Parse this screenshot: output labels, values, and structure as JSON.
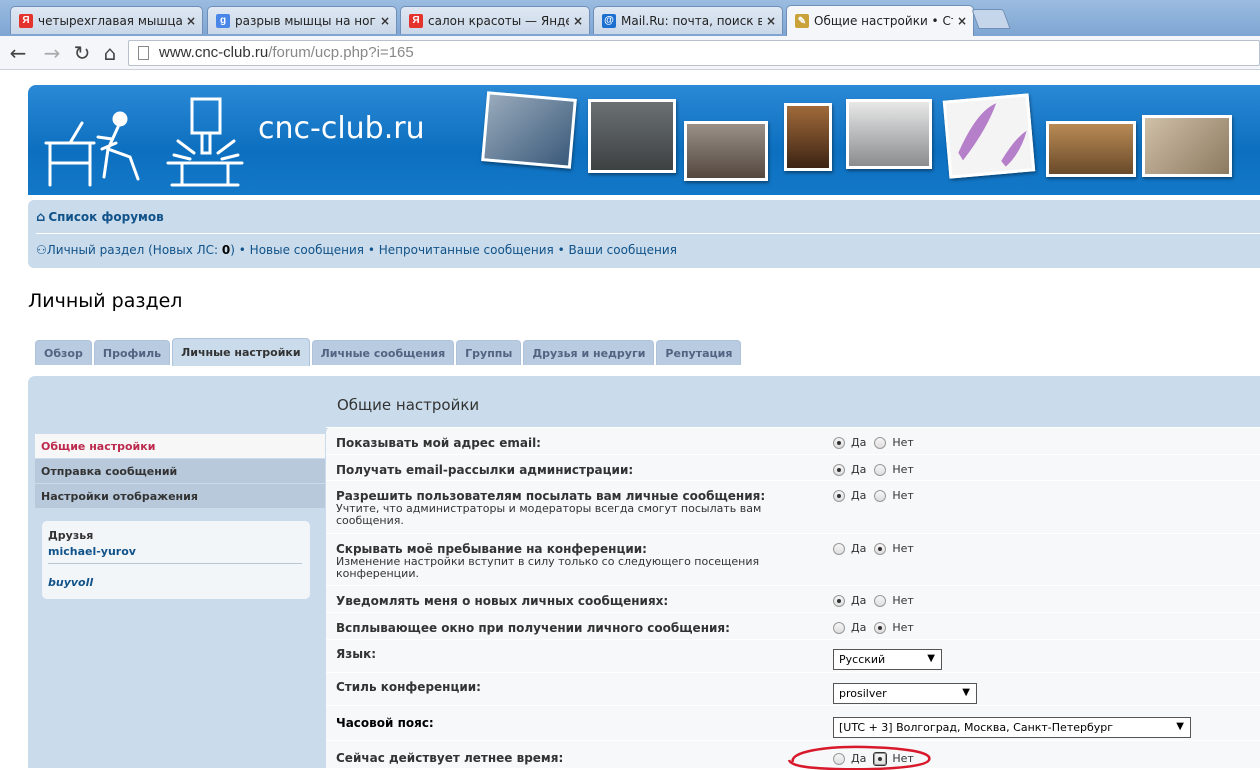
{
  "browser": {
    "tabs": [
      {
        "title": "четырехглавая мышца р",
        "favicon": "yandex-icon",
        "favicon_char": "Я",
        "favicon_color": "#e4332c"
      },
      {
        "title": "разрыв мышцы на ноге",
        "favicon": "google-icon",
        "favicon_char": "g",
        "favicon_color": "#3f7cd8"
      },
      {
        "title": "салон красоты — Яндекс",
        "favicon": "yandex-icon",
        "favicon_char": "Я",
        "favicon_color": "#e4332c"
      },
      {
        "title": "Mail.Ru: почта, поиск в и",
        "favicon": "mailru-icon",
        "favicon_char": "@",
        "favicon_color": "#1a6fd0"
      },
      {
        "title": "Общие настройки • Стан",
        "favicon": "forum-icon",
        "favicon_char": "✎",
        "favicon_color": "#c9a23a"
      }
    ],
    "close_glyph": "×",
    "url_host": "www.cnc-club.ru",
    "url_path": "/forum/ucp.php?i=165"
  },
  "site": {
    "name": "cnc-club.ru"
  },
  "forum_nav": {
    "index_link": "Список форумов",
    "ucp_link": "Личный раздел",
    "new_pm_prefix": " (Новых ЛС: ",
    "new_pm_count": "0",
    "new_pm_suffix": ")",
    "bullet": " • ",
    "new_posts": "Новые сообщения",
    "unread_posts": "Непрочитанные сообщения",
    "your_posts": "Ваши сообщения"
  },
  "page_title": "Личный раздел",
  "ucp_tabs": [
    {
      "label": "Обзор",
      "active": false
    },
    {
      "label": "Профиль",
      "active": false
    },
    {
      "label": "Личные настройки",
      "active": true
    },
    {
      "label": "Личные сообщения",
      "active": false
    },
    {
      "label": "Группы",
      "active": false
    },
    {
      "label": "Друзья и недруги",
      "active": false
    },
    {
      "label": "Репутация",
      "active": false
    }
  ],
  "side_menu": [
    {
      "label": "Общие настройки",
      "active": true
    },
    {
      "label": "Отправка сообщений",
      "active": false
    },
    {
      "label": "Настройки отображения",
      "active": false
    }
  ],
  "friends": {
    "header": "Друзья",
    "online": "michael-yurov",
    "offline": "buyvoll"
  },
  "section_title": "Общие настройки",
  "yes_label": "Да",
  "no_label": "Нет",
  "settings": [
    {
      "label": "Показывать мой адрес email:",
      "desc": "",
      "value": "yes"
    },
    {
      "label": "Получать email-рассылки администрации:",
      "desc": "",
      "value": "yes"
    },
    {
      "label": "Разрешить пользователям посылать вам личные сообщения:",
      "desc": "Учтите, что администраторы и модераторы всегда смогут посылать вам сообщения.",
      "value": "yes"
    },
    {
      "label": "Скрывать моё пребывание на конференции:",
      "desc": "Изменение настройки вступит в силу только со следующего посещения конференции.",
      "value": "no"
    },
    {
      "label": "Уведомлять меня о новых личных сообщениях:",
      "desc": "",
      "value": "yes"
    },
    {
      "label": "Всплывающее окно при получении личного сообщения:",
      "desc": "",
      "value": "no"
    }
  ],
  "language": {
    "label": "Язык:",
    "value": "Русский"
  },
  "style": {
    "label": "Стиль конференции:",
    "value": "prosilver"
  },
  "timezone": {
    "label": "Часовой пояс:",
    "value": "[UTC + 3] Волгоград, Москва, Санкт-Петербург"
  },
  "dst": {
    "label": "Сейчас действует летнее время:",
    "value": "no"
  },
  "colors": {
    "accent": "#105289",
    "header_blue": "#0c6fbf",
    "panel": "#cadceb",
    "active_menu": "#bc2a4d",
    "annotation_red": "#d8182b"
  }
}
